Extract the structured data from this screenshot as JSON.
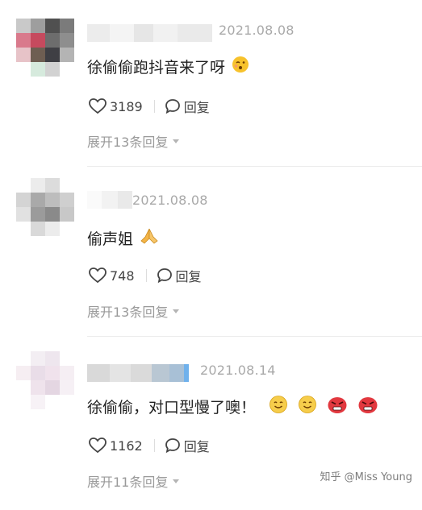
{
  "comments": [
    {
      "date": "2021.08.08",
      "text": "徐偷偷跑抖音来了呀",
      "emojis": [
        "blush-kiss"
      ],
      "likes": "3189",
      "reply_label": "回复",
      "expand_label": "展开13条回复"
    },
    {
      "date": "2021.08.08",
      "text": "偷声姐",
      "emojis": [
        "pray-hands"
      ],
      "likes": "748",
      "reply_label": "回复",
      "expand_label": "展开13条回复"
    },
    {
      "date": "2021.08.14",
      "text": "徐偷偷，对口型慢了噢！",
      "emojis": [
        "smile-face",
        "smile-face",
        "angry-face",
        "angry-face"
      ],
      "likes": "1162",
      "reply_label": "回复",
      "expand_label": "展开11条回复"
    }
  ],
  "watermark": "知乎 @Miss Young",
  "colors": {
    "text": "#222222",
    "meta": "#a9a9a9",
    "action": "#444444",
    "divider": "#ececec"
  }
}
